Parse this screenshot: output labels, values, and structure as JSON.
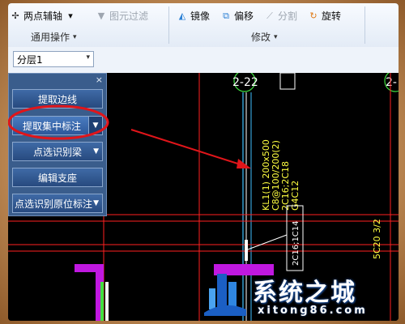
{
  "ribbon": {
    "two_point_axis": "两点辅轴",
    "entity_filter": "图元过滤",
    "group_common": "通用操作",
    "mirror": "镜像",
    "offset": "偏移",
    "split": "分割",
    "rotate": "旋转",
    "group_modify": "修改"
  },
  "layer": {
    "selected": "分层1"
  },
  "panel": {
    "close": "×",
    "buttons": [
      "提取边线",
      "提取集中标注",
      "点选识别梁",
      "编辑支座",
      "点选识别原位标注"
    ]
  },
  "canvas": {
    "axis_labels": [
      "2-22",
      "2-"
    ],
    "beam_annotation": [
      "KL1(1) 200x500",
      "C8@100/200(2)",
      "2C16;2C18",
      "G4C12"
    ],
    "small_label": "2C16;1C14",
    "right_label": "5C20 3/2"
  },
  "watermark": {
    "brand": "系统之城",
    "url": "xitong86.com"
  },
  "colors": {
    "highlight_circle": "#e0151a",
    "arrow": "#e0151a",
    "cad_red": "#ff2020",
    "cad_yellow": "#ffff40",
    "cad_cyan": "#40c0ff",
    "panel_bg": "#3a5d8c"
  }
}
